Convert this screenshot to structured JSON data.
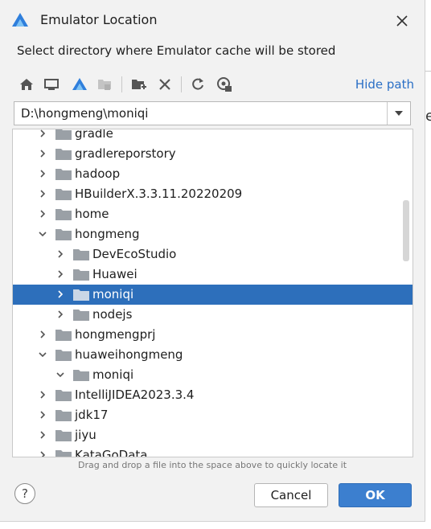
{
  "dialog": {
    "title": "Emulator Location",
    "description": "Select directory where Emulator cache will be stored"
  },
  "toolbar": {
    "buttons": [
      "home-icon",
      "desktop-icon",
      "project-icon",
      "module-icon",
      "new-folder-icon",
      "delete-icon",
      "refresh-icon",
      "show-hidden-icon"
    ],
    "hide_path": "Hide path"
  },
  "path": {
    "value": "D:\\hongmeng\\moniqi"
  },
  "tree": {
    "items": [
      {
        "label": "gradle",
        "level": 0,
        "expanded": false,
        "selected": false
      },
      {
        "label": "gradlereporstory",
        "level": 0,
        "expanded": false,
        "selected": false
      },
      {
        "label": "hadoop",
        "level": 0,
        "expanded": false,
        "selected": false
      },
      {
        "label": "HBuilderX.3.3.11.20220209",
        "level": 0,
        "expanded": false,
        "selected": false
      },
      {
        "label": "home",
        "level": 0,
        "expanded": false,
        "selected": false
      },
      {
        "label": "hongmeng",
        "level": 0,
        "expanded": true,
        "selected": false
      },
      {
        "label": "DevEcoStudio",
        "level": 1,
        "expanded": false,
        "selected": false
      },
      {
        "label": "Huawei",
        "level": 1,
        "expanded": false,
        "selected": false
      },
      {
        "label": "moniqi",
        "level": 1,
        "expanded": false,
        "selected": true
      },
      {
        "label": "nodejs",
        "level": 1,
        "expanded": false,
        "selected": false
      },
      {
        "label": "hongmengprj",
        "level": 0,
        "expanded": false,
        "selected": false
      },
      {
        "label": "huaweihongmeng",
        "level": 0,
        "expanded": true,
        "selected": false
      },
      {
        "label": "moniqi",
        "level": 1,
        "expanded": true,
        "selected": false
      },
      {
        "label": "IntelliJIDEA2023.3.4",
        "level": 0,
        "expanded": false,
        "selected": false
      },
      {
        "label": "jdk17",
        "level": 0,
        "expanded": false,
        "selected": false
      },
      {
        "label": "jiyu",
        "level": 0,
        "expanded": false,
        "selected": false
      },
      {
        "label": "KataGoData",
        "level": 0,
        "expanded": false,
        "selected": false
      }
    ]
  },
  "hint": "Drag and drop a file into the space above to quickly locate it",
  "buttons": {
    "help": "?",
    "cancel": "Cancel",
    "ok": "OK"
  },
  "outer_fragment": "e",
  "colors": {
    "accent": "#2d6fbb",
    "link": "#2a6fc6",
    "ok_button": "#3c7fcf",
    "folder": "#9aa0a6"
  }
}
